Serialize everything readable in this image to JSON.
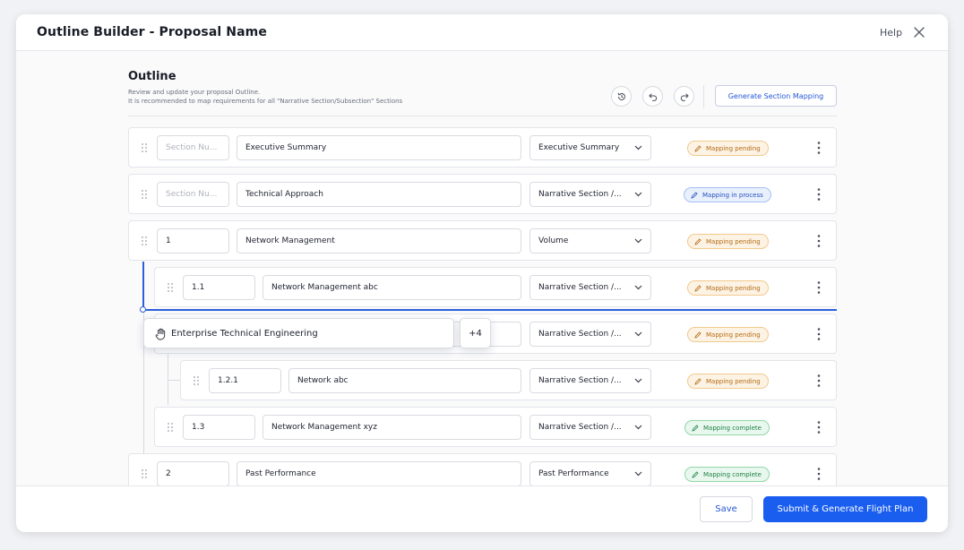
{
  "header": {
    "title": "Outline Builder - Proposal Name",
    "help_label": "Help"
  },
  "outline": {
    "title": "Outline",
    "description_line1": "Review and update your proposal Outline.",
    "description_line2": "It is recommended to map requirements for all \"Narrative Section/Subsection\" Sections",
    "generate_label": "Generate Section Mapping"
  },
  "rows": [
    {
      "number": "",
      "number_placeholder": "Section Nu...",
      "name": "Executive Summary",
      "type": "Executive Summary",
      "status": "Mapping pending"
    },
    {
      "number": "",
      "number_placeholder": "Section Nu...",
      "name": "Technical Approach",
      "type": "Narrative Section /...",
      "status": "Mapping in process"
    },
    {
      "number": "1",
      "name": "Network Management",
      "type": "Volume",
      "status": "Mapping pending"
    },
    {
      "number": "1.1",
      "name": "Network Management abc",
      "type": "Narrative Section /...",
      "status": "Mapping pending"
    },
    {
      "number": "",
      "name": "",
      "type": "Narrative Section /...",
      "status": "Mapping pending"
    },
    {
      "number": "1.2.1",
      "name": "Network abc",
      "type": "Narrative Section /...",
      "status": "Mapping pending"
    },
    {
      "number": "1.3",
      "name": "Network Management xyz",
      "type": "Narrative Section /...",
      "status": "Mapping complete"
    },
    {
      "number": "2",
      "name": "Past Performance",
      "type": "Past Performance",
      "status": "Mapping complete"
    }
  ],
  "drag_ghost": {
    "label": "Enterprise Technical Engineering",
    "extra_count": "+4"
  },
  "footer": {
    "save_label": "Save",
    "submit_label": "Submit & Generate Flight Plan"
  },
  "colors": {
    "accent": "#1a5ef0",
    "pending": "#b26a14",
    "in_process": "#2552b8",
    "complete": "#1f8146"
  },
  "icons": {
    "history": "history-icon",
    "undo": "undo-icon",
    "redo": "redo-icon",
    "close": "close-icon",
    "drag": "drag-handle-icon",
    "more": "more-vertical-icon",
    "pencil": "pencil-icon",
    "hand": "grab-hand-icon",
    "chevron": "chevron-down-icon"
  }
}
